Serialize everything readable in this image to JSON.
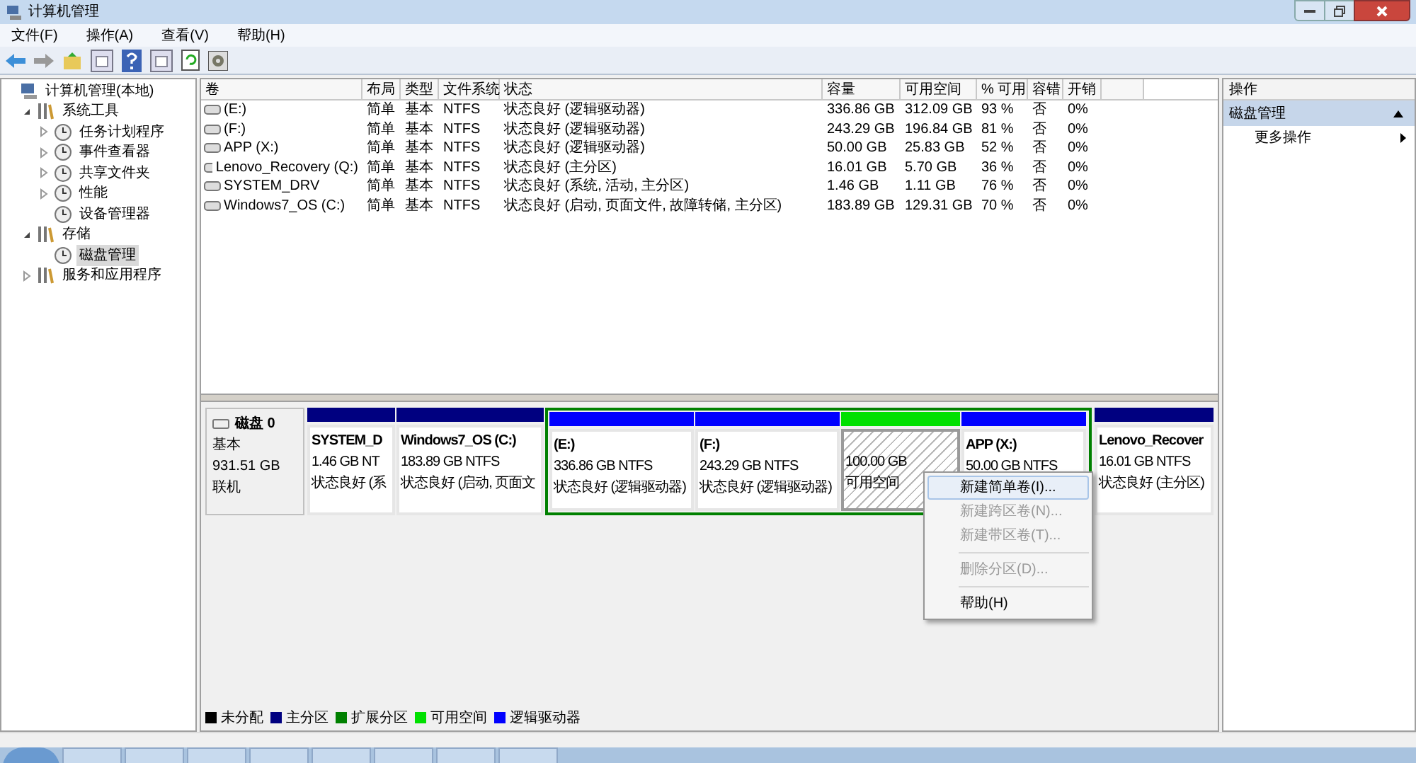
{
  "window": {
    "title": "计算机管理"
  },
  "menu": [
    "文件(F)",
    "操作(A)",
    "查看(V)",
    "帮助(H)"
  ],
  "tree": [
    {
      "label": "计算机管理(本地)",
      "selected": false,
      "children": [
        {
          "label": "系统工具",
          "selected": false,
          "expanded": true,
          "children": [
            {
              "label": "任务计划程序",
              "selected": false,
              "expanded": false
            },
            {
              "label": "事件查看器",
              "selected": false,
              "expanded": false
            },
            {
              "label": "共享文件夹",
              "selected": false,
              "expanded": false
            },
            {
              "label": "性能",
              "selected": false,
              "expanded": false
            },
            {
              "label": "设备管理器",
              "selected": false
            }
          ]
        },
        {
          "label": "存储",
          "selected": false,
          "expanded": true,
          "children": [
            {
              "label": "磁盘管理",
              "selected": true
            }
          ]
        },
        {
          "label": "服务和应用程序",
          "selected": false,
          "expanded": false
        }
      ]
    }
  ],
  "table": {
    "columns": [
      "卷",
      "布局",
      "类型",
      "文件系统",
      "状态",
      "容量",
      "可用空间",
      "% 可用",
      "容错",
      "开销"
    ],
    "rows": [
      [
        "(E:)",
        "简单",
        "基本",
        "NTFS",
        "状态良好 (逻辑驱动器)",
        "336.86 GB",
        "312.09 GB",
        "93 %",
        "否",
        "0%"
      ],
      [
        "(F:)",
        "简单",
        "基本",
        "NTFS",
        "状态良好 (逻辑驱动器)",
        "243.29 GB",
        "196.84 GB",
        "81 %",
        "否",
        "0%"
      ],
      [
        "APP (X:)",
        "简单",
        "基本",
        "NTFS",
        "状态良好 (逻辑驱动器)",
        "50.00 GB",
        "25.83 GB",
        "52 %",
        "否",
        "0%"
      ],
      [
        "Lenovo_Recovery (Q:)",
        "简单",
        "基本",
        "NTFS",
        "状态良好 (主分区)",
        "16.01 GB",
        "5.70 GB",
        "36 %",
        "否",
        "0%"
      ],
      [
        "SYSTEM_DRV",
        "简单",
        "基本",
        "NTFS",
        "状态良好 (系统, 活动, 主分区)",
        "1.46 GB",
        "1.11 GB",
        "76 %",
        "否",
        "0%"
      ],
      [
        "Windows7_OS (C:)",
        "简单",
        "基本",
        "NTFS",
        "状态良好 (启动, 页面文件, 故障转储, 主分区)",
        "183.89 GB",
        "129.31 GB",
        "70 %",
        "否",
        "0%"
      ]
    ]
  },
  "disk": {
    "name": "磁盘 0",
    "type": "基本",
    "size": "931.51 GB",
    "state": "联机",
    "partitions": [
      {
        "kind": "primary",
        "title": "SYSTEM_D",
        "size": "1.46 GB NT",
        "status": "状态良好 (系",
        "color": "#000080",
        "selected": false
      },
      {
        "kind": "primary",
        "title": "Windows7_OS  (C:)",
        "size": "183.89 GB NTFS",
        "status": "状态良好 (启动, 页面文",
        "color": "#000080",
        "selected": false
      },
      {
        "kind": "extended",
        "color": "#008000",
        "children": [
          {
            "kind": "logical",
            "title": "(E:)",
            "size": "336.86 GB NTFS",
            "status": "状态良好 (逻辑驱动器)",
            "color": "#0000ff",
            "selected": false
          },
          {
            "kind": "logical",
            "title": "(F:)",
            "size": "243.29 GB NTFS",
            "status": "状态良好 (逻辑驱动器)",
            "color": "#0000ff",
            "selected": false
          },
          {
            "kind": "free",
            "size": "100.00 GB",
            "status": "可用空间",
            "color": "#00e000",
            "selected": true
          },
          {
            "kind": "logical",
            "title": "APP  (X:)",
            "size": "50.00 GB NTFS",
            "color": "#0000ff",
            "selected": false
          }
        ]
      },
      {
        "kind": "primary",
        "title": "Lenovo_Recover",
        "size": "16.01 GB NTFS",
        "status": "状态良好 (主分区)",
        "color": "#000080",
        "selected": false
      }
    ]
  },
  "legend": [
    {
      "label": "未分配",
      "color": "#000000"
    },
    {
      "label": "主分区",
      "color": "#000080"
    },
    {
      "label": "扩展分区",
      "color": "#008000"
    },
    {
      "label": "可用空间",
      "color": "#00e000"
    },
    {
      "label": "逻辑驱动器",
      "color": "#0000ff"
    }
  ],
  "context_menu": [
    {
      "kind": "item",
      "label": "新建简单卷(I)...",
      "disabled": false,
      "selected": true
    },
    {
      "kind": "item",
      "label": "新建跨区卷(N)...",
      "disabled": true,
      "selected": false
    },
    {
      "kind": "item",
      "label": "新建带区卷(T)...",
      "disabled": true,
      "selected": false
    },
    {
      "kind": "separator"
    },
    {
      "kind": "item",
      "label": "删除分区(D)...",
      "disabled": true,
      "selected": false
    },
    {
      "kind": "separator"
    },
    {
      "kind": "item",
      "label": "帮助(H)",
      "disabled": false,
      "selected": false
    }
  ],
  "actions": {
    "header": "操作",
    "section": {
      "label": "磁盘管理",
      "expanded": true
    },
    "items": [
      "更多操作"
    ]
  }
}
